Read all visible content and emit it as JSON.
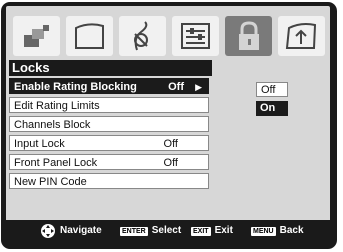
{
  "menu_title": "Locks",
  "tabs": [
    {
      "icon": "picture-icon"
    },
    {
      "icon": "screen-icon"
    },
    {
      "icon": "audio-icon"
    },
    {
      "icon": "settings-icon"
    },
    {
      "icon": "lock-icon",
      "active": true
    },
    {
      "icon": "upload-icon"
    }
  ],
  "items": [
    {
      "label": "Enable Rating Blocking",
      "value": "Off",
      "arrow": "▶",
      "selected": true
    },
    {
      "label": "Edit Rating Limits"
    },
    {
      "label": "Channels Block"
    },
    {
      "label": "Input Lock",
      "value": "Off"
    },
    {
      "label": "Front Panel Lock",
      "value": "Off"
    },
    {
      "label": "New PIN Code"
    }
  ],
  "options": [
    {
      "label": "Off",
      "highlighted": false
    },
    {
      "label": "On",
      "highlighted": true
    }
  ],
  "footer": {
    "navigate": "Navigate",
    "enter_key": "ENTER",
    "select": "Select",
    "exit_key": "EXIT",
    "exit": "Exit",
    "menu_key": "MENU",
    "back": "Back"
  },
  "colors": {
    "frame": "#1a1a1a",
    "panel": "#d7d7d7",
    "selected": "#1b1b1b"
  }
}
